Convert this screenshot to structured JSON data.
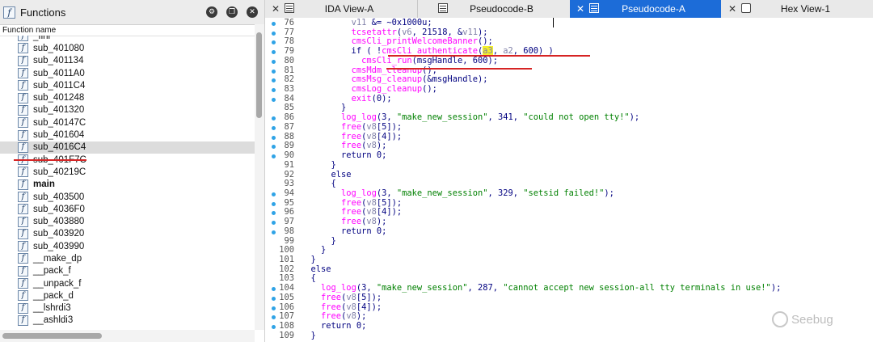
{
  "left_panel": {
    "title": "Functions",
    "icon": "function-icon",
    "column_header": "Function name",
    "header_buttons": [
      "settings-icon",
      "copy-icon",
      "close-icon"
    ],
    "functions": [
      {
        "name": "_fini"
      },
      {
        "name": "sub_401080"
      },
      {
        "name": "sub_401134"
      },
      {
        "name": "sub_4011A0"
      },
      {
        "name": "sub_4011C4"
      },
      {
        "name": "sub_401248"
      },
      {
        "name": "sub_401320"
      },
      {
        "name": "sub_40147C"
      },
      {
        "name": "sub_401604"
      },
      {
        "name": "sub_4016C4",
        "selected": true
      },
      {
        "name": "sub_401F7C"
      },
      {
        "name": "sub_40219C"
      },
      {
        "name": "main",
        "bold": true
      },
      {
        "name": "sub_403500"
      },
      {
        "name": "sub_4036F0"
      },
      {
        "name": "sub_403880"
      },
      {
        "name": "sub_403920"
      },
      {
        "name": "sub_403990"
      },
      {
        "name": "__make_dp"
      },
      {
        "name": "__pack_f"
      },
      {
        "name": "__unpack_f"
      },
      {
        "name": "__pack_d"
      },
      {
        "name": "__lshrdi3"
      },
      {
        "name": "__ashldi3"
      }
    ]
  },
  "tabs": [
    {
      "label": "IDA View-A",
      "active": false,
      "icon": "ida-view-icon"
    },
    {
      "label": "Pseudocode-B",
      "active": false,
      "icon": "pseudocode-icon"
    },
    {
      "label": "Pseudocode-A",
      "active": true,
      "icon": "pseudocode-icon"
    },
    {
      "label": "Hex View-1",
      "active": false,
      "icon": "hex-view-icon"
    }
  ],
  "code_lines": [
    {
      "n": "76",
      "dot": true,
      "segs": [
        [
          "          ",
          ""
        ],
        [
          "v11",
          "g"
        ],
        [
          " &= ~0x1000u;",
          ""
        ]
      ]
    },
    {
      "n": "77",
      "dot": true,
      "segs": [
        [
          "          ",
          ""
        ],
        [
          "tcsetattr",
          "p"
        ],
        [
          "(",
          ""
        ],
        [
          "v6",
          "g"
        ],
        [
          ", 21518, &",
          ""
        ],
        [
          "v11",
          "g"
        ],
        [
          ");",
          ""
        ]
      ]
    },
    {
      "n": "78",
      "dot": true,
      "segs": [
        [
          "          ",
          ""
        ],
        [
          "cmsCli_printWelcomeBanner",
          "p"
        ],
        [
          "();",
          ""
        ]
      ]
    },
    {
      "n": "79",
      "dot": true,
      "segs": [
        [
          "          if ( !",
          ""
        ],
        [
          "cmsCli_authenticate",
          "p"
        ],
        [
          "(",
          ""
        ],
        [
          "a3",
          "h"
        ],
        [
          ", ",
          ""
        ],
        [
          "a2",
          "g"
        ],
        [
          ", 600) )",
          ""
        ]
      ]
    },
    {
      "n": "80",
      "dot": true,
      "segs": [
        [
          "            ",
          ""
        ],
        [
          "cmsCli_run",
          "p"
        ],
        [
          "(msgHandle, 600);",
          ""
        ]
      ]
    },
    {
      "n": "81",
      "dot": true,
      "segs": [
        [
          "          ",
          ""
        ],
        [
          "cmsMdm_cleanup",
          "p"
        ],
        [
          "();",
          ""
        ]
      ]
    },
    {
      "n": "82",
      "dot": true,
      "segs": [
        [
          "          ",
          ""
        ],
        [
          "cmsMsg_cleanup",
          "p"
        ],
        [
          "(&msgHandle);",
          ""
        ]
      ]
    },
    {
      "n": "83",
      "dot": true,
      "segs": [
        [
          "          ",
          ""
        ],
        [
          "cmsLog_cleanup",
          "p"
        ],
        [
          "();",
          ""
        ]
      ]
    },
    {
      "n": "84",
      "dot": true,
      "segs": [
        [
          "          ",
          ""
        ],
        [
          "exit",
          "p"
        ],
        [
          "(0);",
          ""
        ]
      ]
    },
    {
      "n": "85",
      "dot": false,
      "segs": [
        [
          "        }",
          ""
        ]
      ]
    },
    {
      "n": "86",
      "dot": true,
      "segs": [
        [
          "        ",
          ""
        ],
        [
          "log_log",
          "p"
        ],
        [
          "(3, ",
          ""
        ],
        [
          "\"make_new_session\"",
          "s"
        ],
        [
          ", 341, ",
          ""
        ],
        [
          "\"could not open tty!\"",
          "s"
        ],
        [
          ");",
          ""
        ]
      ]
    },
    {
      "n": "87",
      "dot": true,
      "segs": [
        [
          "        ",
          ""
        ],
        [
          "free",
          "p"
        ],
        [
          "(",
          ""
        ],
        [
          "v8",
          "g"
        ],
        [
          "[5]);",
          ""
        ]
      ]
    },
    {
      "n": "88",
      "dot": true,
      "segs": [
        [
          "        ",
          ""
        ],
        [
          "free",
          "p"
        ],
        [
          "(",
          ""
        ],
        [
          "v8",
          "g"
        ],
        [
          "[4]);",
          ""
        ]
      ]
    },
    {
      "n": "89",
      "dot": true,
      "segs": [
        [
          "        ",
          ""
        ],
        [
          "free",
          "p"
        ],
        [
          "(",
          ""
        ],
        [
          "v8",
          "g"
        ],
        [
          ");",
          ""
        ]
      ]
    },
    {
      "n": "90",
      "dot": true,
      "segs": [
        [
          "        return 0;",
          ""
        ]
      ]
    },
    {
      "n": "91",
      "dot": false,
      "segs": [
        [
          "      }",
          ""
        ]
      ]
    },
    {
      "n": "92",
      "dot": false,
      "segs": [
        [
          "      else",
          ""
        ]
      ]
    },
    {
      "n": "93",
      "dot": false,
      "segs": [
        [
          "      {",
          ""
        ]
      ]
    },
    {
      "n": "94",
      "dot": true,
      "segs": [
        [
          "        ",
          ""
        ],
        [
          "log_log",
          "p"
        ],
        [
          "(3, ",
          ""
        ],
        [
          "\"make_new_session\"",
          "s"
        ],
        [
          ", 329, ",
          ""
        ],
        [
          "\"setsid failed!\"",
          "s"
        ],
        [
          ");",
          ""
        ]
      ]
    },
    {
      "n": "95",
      "dot": true,
      "segs": [
        [
          "        ",
          ""
        ],
        [
          "free",
          "p"
        ],
        [
          "(",
          ""
        ],
        [
          "v8",
          "g"
        ],
        [
          "[5]);",
          ""
        ]
      ]
    },
    {
      "n": "96",
      "dot": true,
      "segs": [
        [
          "        ",
          ""
        ],
        [
          "free",
          "p"
        ],
        [
          "(",
          ""
        ],
        [
          "v8",
          "g"
        ],
        [
          "[4]);",
          ""
        ]
      ]
    },
    {
      "n": "97",
      "dot": true,
      "segs": [
        [
          "        ",
          ""
        ],
        [
          "free",
          "p"
        ],
        [
          "(",
          ""
        ],
        [
          "v8",
          "g"
        ],
        [
          ");",
          ""
        ]
      ]
    },
    {
      "n": "98",
      "dot": true,
      "segs": [
        [
          "        return 0;",
          ""
        ]
      ]
    },
    {
      "n": "99",
      "dot": false,
      "segs": [
        [
          "      }",
          ""
        ]
      ]
    },
    {
      "n": "100",
      "dot": false,
      "segs": [
        [
          "    }",
          ""
        ]
      ]
    },
    {
      "n": "101",
      "dot": false,
      "segs": [
        [
          "  }",
          ""
        ]
      ]
    },
    {
      "n": "102",
      "dot": false,
      "segs": [
        [
          "  else",
          ""
        ]
      ]
    },
    {
      "n": "103",
      "dot": false,
      "segs": [
        [
          "  {",
          ""
        ]
      ]
    },
    {
      "n": "104",
      "dot": true,
      "segs": [
        [
          "    ",
          ""
        ],
        [
          "log_log",
          "p"
        ],
        [
          "(3, ",
          ""
        ],
        [
          "\"make_new_session\"",
          "s"
        ],
        [
          ", 287, ",
          ""
        ],
        [
          "\"cannot accept new session-all tty terminals in use!\"",
          "s"
        ],
        [
          ");",
          ""
        ]
      ]
    },
    {
      "n": "105",
      "dot": true,
      "segs": [
        [
          "    ",
          ""
        ],
        [
          "free",
          "p"
        ],
        [
          "(",
          ""
        ],
        [
          "v8",
          "g"
        ],
        [
          "[5]);",
          ""
        ]
      ]
    },
    {
      "n": "106",
      "dot": true,
      "segs": [
        [
          "    ",
          ""
        ],
        [
          "free",
          "p"
        ],
        [
          "(",
          ""
        ],
        [
          "v8",
          "g"
        ],
        [
          "[4]);",
          ""
        ]
      ]
    },
    {
      "n": "107",
      "dot": true,
      "segs": [
        [
          "    ",
          ""
        ],
        [
          "free",
          "p"
        ],
        [
          "(",
          ""
        ],
        [
          "v8",
          "g"
        ],
        [
          ");",
          ""
        ]
      ]
    },
    {
      "n": "108",
      "dot": true,
      "segs": [
        [
          "    return 0;",
          ""
        ]
      ]
    },
    {
      "n": "109",
      "dot": false,
      "segs": [
        [
          "  }",
          ""
        ]
      ]
    }
  ],
  "watermark": {
    "text": "Seebug",
    "icon": "seebug-logo-icon"
  },
  "colors": {
    "accent": "#1c6cd8",
    "func_name": "#ff00ff",
    "string": "#008000",
    "variable": "#8080a8",
    "code_default": "#000080",
    "highlight": "#f5f02a",
    "annotation": "#d62424",
    "breakpoint_dot": "#2fa3e6"
  }
}
